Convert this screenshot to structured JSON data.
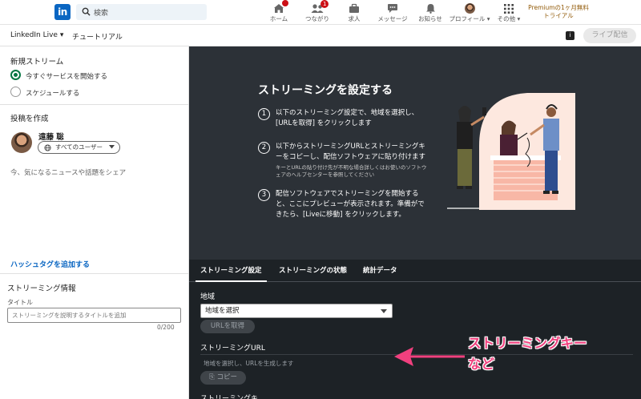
{
  "nav": {
    "logo": "in",
    "search_placeholder": "検索",
    "items": [
      {
        "label": "ホーム",
        "icon": "home-icon",
        "badge": ""
      },
      {
        "label": "つながり",
        "icon": "network-icon",
        "badge": "1"
      },
      {
        "label": "求人",
        "icon": "briefcase-icon",
        "badge": ""
      },
      {
        "label": "メッセージ",
        "icon": "message-icon",
        "badge": ""
      },
      {
        "label": "お知らせ",
        "icon": "bell-icon",
        "badge": ""
      },
      {
        "label": "プロフィール",
        "icon": "profile-avatar",
        "badge": ""
      },
      {
        "label": "その他",
        "icon": "grid-icon",
        "badge": ""
      }
    ],
    "premium_line1": "Premiumの1ヶ月無料",
    "premium_line2": "トライアル"
  },
  "subheader": {
    "live_label": "LinkedIn Live",
    "tutorial_label": "チュートリアル",
    "golive_label": "ライブ配信"
  },
  "left": {
    "new_stream_heading": "新規ストリーム",
    "option_now": "今すぐサービスを開始する",
    "option_schedule": "スケジュールする",
    "post_heading": "投稿を作成",
    "user_name": "遠藤 聡",
    "visibility": "すべてのユーザー",
    "share_prompt": "今、気になるニュースや話題をシェア",
    "hashtag_link": "ハッシュタグを追加する",
    "stream_info_heading": "ストリーミング情報",
    "title_label": "タイトル",
    "title_placeholder": "ストリーミングを説明するタイトルを追加",
    "title_counter": "0/200"
  },
  "guide": {
    "title": "ストリーミングを設定する",
    "steps": [
      {
        "num": "1",
        "line1": "以下のストリーミング設定で、地域を選択し、",
        "line2": "[URLを取得] をクリックします"
      },
      {
        "num": "2",
        "line1": "以下からストリーミングURLとストリーミングキ",
        "line2": "ーをコピーし、配信ソフトウェアに貼り付けます",
        "note1": "キーとURLの貼り付け先が不明な場合詳しくはお使いのソフトウ",
        "note2": "ェアのヘルプセンターを参照してください"
      },
      {
        "num": "3",
        "line1": "配信ソフトウェアでストリーミングを開始する",
        "line2": "と、ここにプレビューが表示されます。準備がで",
        "line3": "きたら、[Liveに移動] をクリックします。"
      }
    ]
  },
  "tabs": [
    "ストリーミング設定",
    "ストリーミングの状態",
    "統計データ"
  ],
  "settings": {
    "region_label": "地域",
    "region_value": "地域を選択",
    "get_url_button": "URLを取得",
    "stream_url_label": "ストリーミングURL",
    "url_placeholder": "地域を選択し、URLを生成します",
    "copy_button": "コピー",
    "stream_key_label": "ストリーミングキ"
  },
  "annotation": {
    "line1": "ストリーミングキー",
    "line2": "など",
    "color": "#f0407e"
  }
}
